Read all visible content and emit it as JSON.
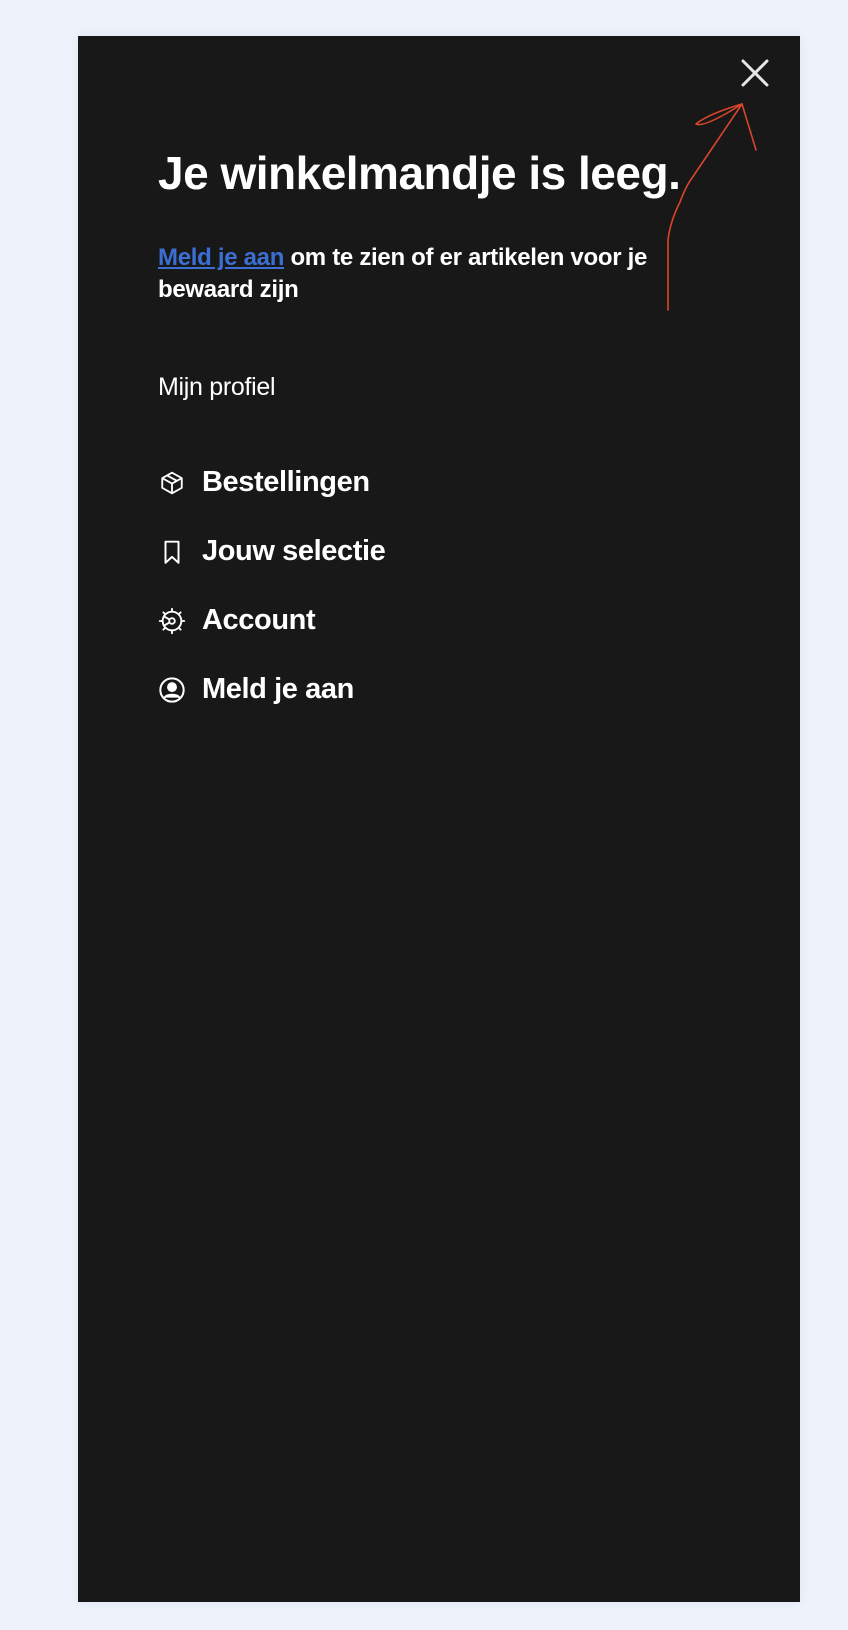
{
  "cart": {
    "title": "Je winkelmandje is leeg.",
    "signin_link": "Meld je aan",
    "signin_text": " om te zien of er artikelen voor je bewaard zijn"
  },
  "profile": {
    "section_label": "Mijn profiel",
    "items": [
      {
        "label": "Bestellingen",
        "icon": "package-icon"
      },
      {
        "label": "Jouw selectie",
        "icon": "bookmark-icon"
      },
      {
        "label": "Account",
        "icon": "gear-icon"
      },
      {
        "label": "Meld je aan",
        "icon": "user-circle-icon"
      }
    ]
  },
  "colors": {
    "page_background": "#eef2fa",
    "panel_background": "#181818",
    "link": "#3b6fd4",
    "annotation": "#d9452b"
  },
  "icons": {
    "close": "close-icon"
  }
}
